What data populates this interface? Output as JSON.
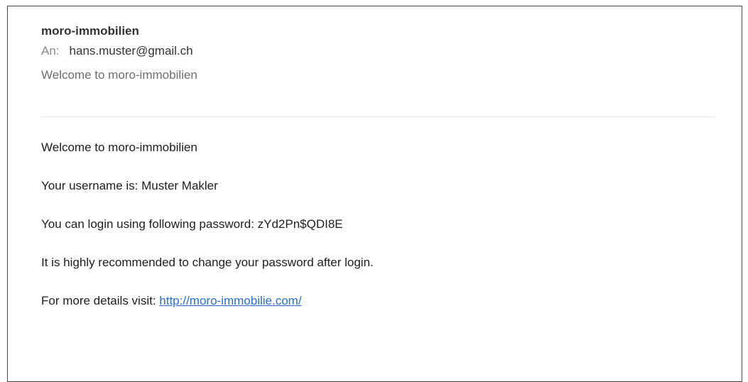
{
  "header": {
    "sender": "moro-immobilien",
    "to_label": "An:",
    "to_value": "hans.muster@gmail.ch",
    "subject": "Welcome to moro-immobilien"
  },
  "body": {
    "line1": "Welcome to moro-immobilien",
    "line2": "Your username is: Muster Makler",
    "line3": "You can login using following password: zYd2Pn$QDI8E",
    "line4": "It is highly recommended to change your password after login.",
    "line5_prefix": "For more details visit: ",
    "line5_link": "http://moro-immobilie.com/"
  },
  "colors": {
    "link": "#2a6fd1",
    "label_gray": "#8a8a8a",
    "subject_gray": "#6e6e6e"
  }
}
